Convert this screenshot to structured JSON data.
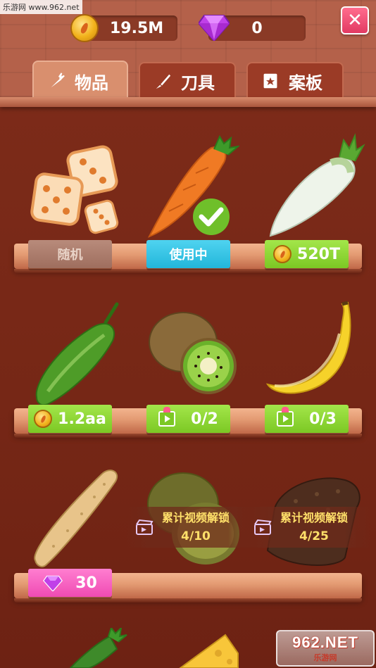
{
  "watermark_top": "乐游网 www.962.net",
  "currency": {
    "coins": "19.5M",
    "gems": "0"
  },
  "tabs": [
    {
      "label": "物品",
      "icon": "carrot-icon",
      "active": true
    },
    {
      "label": "刀具",
      "icon": "knife-icon",
      "active": false
    },
    {
      "label": "案板",
      "icon": "board-icon",
      "active": false
    }
  ],
  "items": [
    {
      "name": "dice",
      "button": "随机",
      "style": "grey"
    },
    {
      "name": "carrot",
      "button": "使用中",
      "style": "blue",
      "selected": true
    },
    {
      "name": "radish",
      "button": "520T",
      "style": "green",
      "price_icon": "coin-icon"
    },
    {
      "name": "cucumber",
      "button": "1.2aa",
      "style": "green",
      "price_icon": "coin-icon"
    },
    {
      "name": "kiwi",
      "button": "0/2",
      "style": "green",
      "price_icon": "video-icon"
    },
    {
      "name": "banana",
      "button": "0/3",
      "style": "green",
      "price_icon": "video-icon"
    },
    {
      "name": "potato-stick",
      "button": "30",
      "style": "pink",
      "price_icon": "gem-icon"
    },
    {
      "name": "melon",
      "unlock_text": "累计视频解锁",
      "unlock_count": "4/10"
    },
    {
      "name": "bread",
      "unlock_text": "累计视频解锁",
      "unlock_count": "4/25"
    }
  ],
  "watermark_bottom": {
    "main": "962.NET",
    "sub": "乐游网"
  },
  "colors": {
    "background": "#7a2a18",
    "accent_green": "#7cc824",
    "accent_blue": "#22b6da",
    "accent_pink": "#ef4bb3",
    "close_button": "#e23a62",
    "unlock_text": "#ffe06a"
  }
}
